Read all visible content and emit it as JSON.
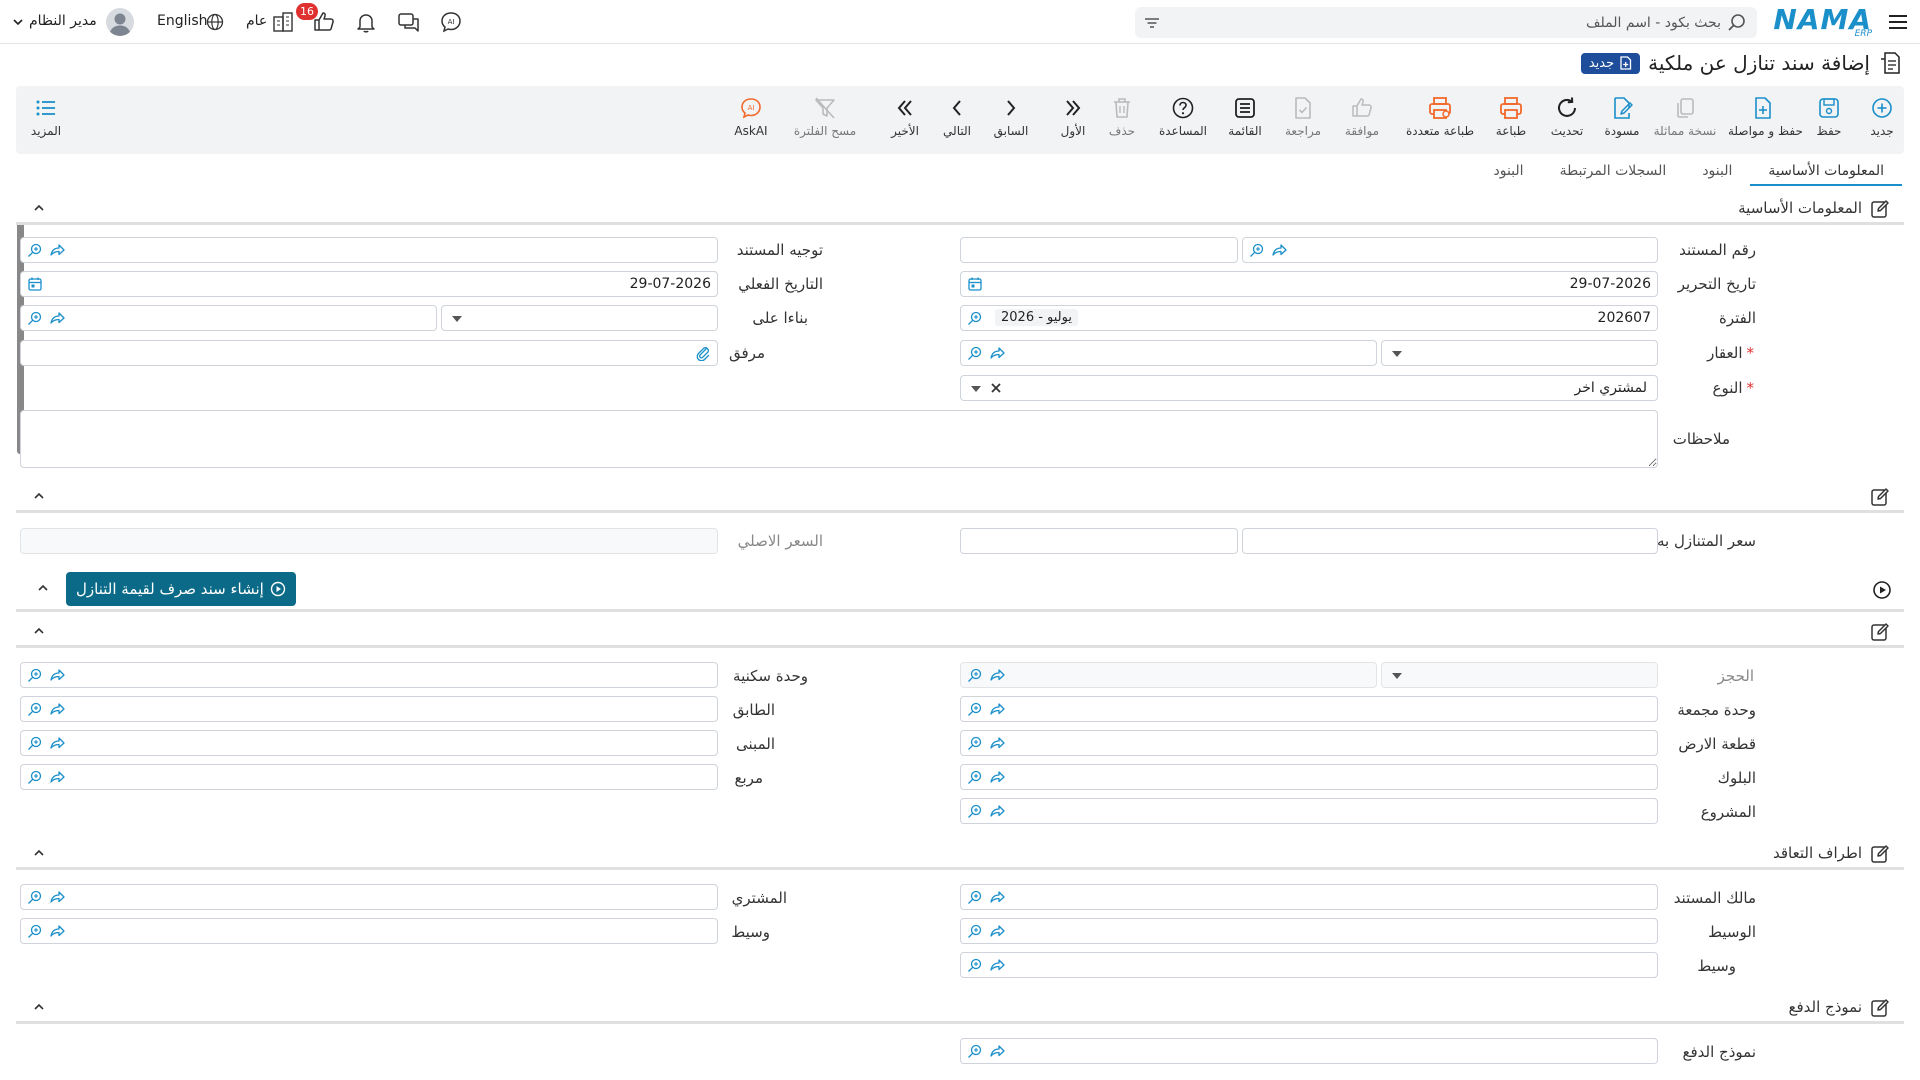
{
  "topbar": {
    "logo_text": "NAMA",
    "logo_sub": "ERP",
    "search_placeholder": "بحث بكود - اسم الملف",
    "notif_count": "16",
    "company_label": "عام",
    "language": "English",
    "user_name": "مدير النظام"
  },
  "page": {
    "title": "إضافة سند تنازل عن ملكية",
    "new_badge": "جديد"
  },
  "toolbar": {
    "new": "جديد",
    "save": "حفظ",
    "save_continue": "حفظ و مواصلة",
    "copy": "نسخة مماثلة",
    "draft": "مسودة",
    "refresh": "تحديث",
    "print": "طباعة",
    "multi_print": "طباعة متعددة",
    "approve": "موافقة",
    "review": "مراجعة",
    "list": "القائمة",
    "help": "المساعدة",
    "delete": "حذف",
    "first": "الأول",
    "previous": "السابق",
    "next": "التالي",
    "last": "الأخير",
    "clear_filter": "مسح الفلترة",
    "askai": "AskAI",
    "more": "المزيد"
  },
  "tabs": [
    "المعلومات الأساسية",
    "البنود",
    "السجلات المرتبطة",
    "البنود"
  ],
  "basic": {
    "section_title": "المعلومات الأساسية",
    "doc_number_label": "رقم المستند",
    "doc_direction_label": "توجيه المستند",
    "edit_date_label": "تاريخ التحرير",
    "edit_date_value": "29-07-2026",
    "actual_date_label": "التاريخ الفعلي",
    "actual_date_value": "29-07-2026",
    "period_label": "الفترة",
    "period_value": "202607",
    "period_chip": "2026 - يوليو",
    "based_on_label": "بناءا على",
    "property_label": "العقار",
    "attachment_label": "مرفق",
    "type_label": "النوع",
    "type_value": "لمشتري اخر",
    "notes_label": "ملاحظات"
  },
  "price": {
    "assigned_price_label": "سعر المتنازل به",
    "original_price_label": "السعر الاصلي"
  },
  "action": {
    "create_voucher": "إنشاء سند صرف لقيمة التنازل"
  },
  "unit": {
    "reservation_label": "الحجز",
    "residential_unit_label": "وحدة سكنية",
    "combined_unit_label": "وحدة مجمعة",
    "floor_label": "الطابق",
    "land_plot_label": "قطعة الارض",
    "building_label": "المبنى",
    "block_label": "البلوك",
    "square_label": "مربع",
    "project_label": "المشروع"
  },
  "parties": {
    "section_title": "اطراف التعاقد",
    "doc_owner_label": "مالك المستند",
    "buyer_label": "المشتري",
    "broker_label": "الوسيط",
    "broker2_label": "وسيط",
    "broker3_label": "وسيط"
  },
  "payment": {
    "section_title": "نموذج الدفع",
    "payment_model_label": "نموذج الدفع"
  },
  "colors": {
    "accent": "#1b8fc9",
    "orange": "#f2692b",
    "primary_button": "#0a6a87",
    "badge": "#1e4d9b",
    "notif": "#e03131"
  }
}
